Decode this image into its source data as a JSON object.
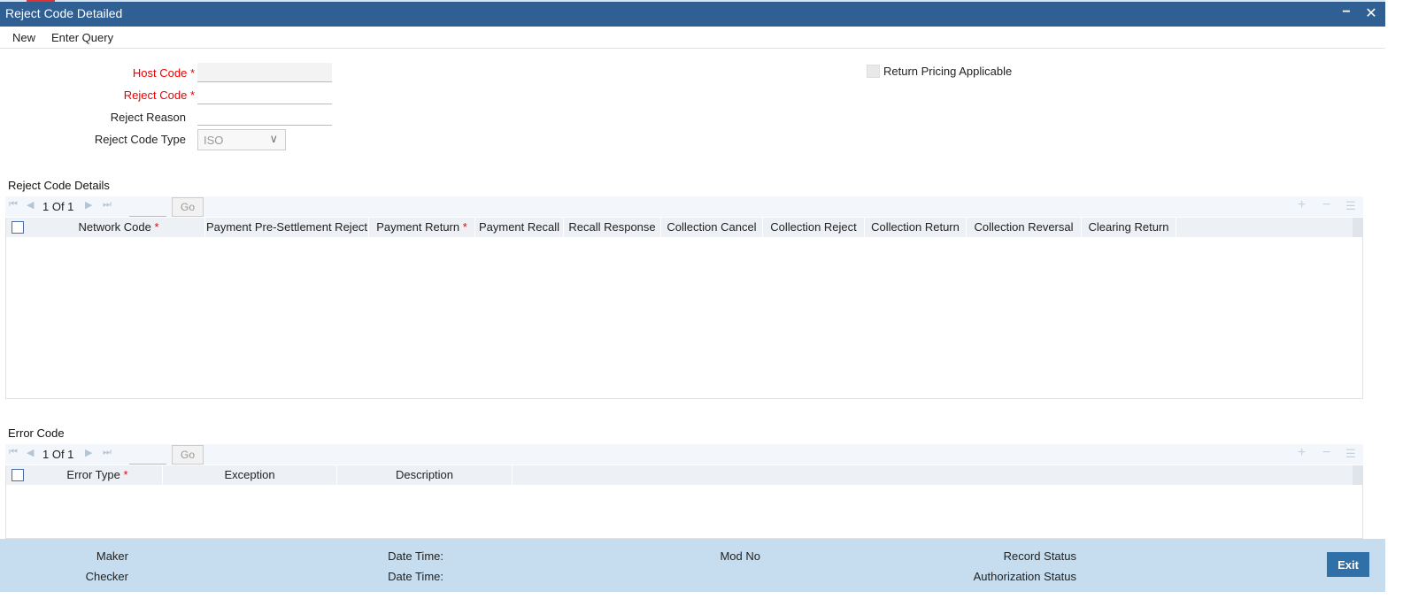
{
  "window": {
    "title": "Reject Code Detailed",
    "minimize_glyph": "−",
    "close_glyph": "✕"
  },
  "menu": {
    "new": "New",
    "enter_query": "Enter Query"
  },
  "form": {
    "host_code_label": "Host Code",
    "reject_code_label": "Reject Code",
    "reject_reason_label": "Reject Reason",
    "reject_code_type_label": "Reject Code Type",
    "reject_code_type_value": "ISO",
    "required_mark": "*",
    "return_pricing_label": "Return Pricing Applicable"
  },
  "reject_details": {
    "section_title": "Reject Code Details",
    "pagination": "1 Of 1",
    "go_label": "Go",
    "columns": [
      "Network Code",
      "Payment Pre-Settlement Reject",
      "Payment Return",
      "Payment Recall",
      "Recall Response",
      "Collection Cancel",
      "Collection Reject",
      "Collection Return",
      "Collection Reversal",
      "Clearing Return"
    ]
  },
  "error_code": {
    "section_title": "Error Code",
    "pagination": "1 Of 1",
    "go_label": "Go",
    "columns": [
      "Error Type",
      "Exception",
      "Description"
    ]
  },
  "footer": {
    "maker": "Maker",
    "checker": "Checker",
    "date_time_1": "Date Time:",
    "date_time_2": "Date Time:",
    "mod_no": "Mod No",
    "record_status": "Record Status",
    "authorization_status": "Authorization Status",
    "exit": "Exit"
  },
  "icons": {
    "first": "⏮",
    "prev": "◀",
    "next": "▶",
    "last": "⏭",
    "add": "+",
    "remove": "−",
    "list": "☰",
    "chevron": "∨"
  },
  "colors": {
    "titlebar": "#2f5f93",
    "required": "#e00000",
    "footer": "#c5ddee",
    "exit_button": "#2f70a9"
  }
}
